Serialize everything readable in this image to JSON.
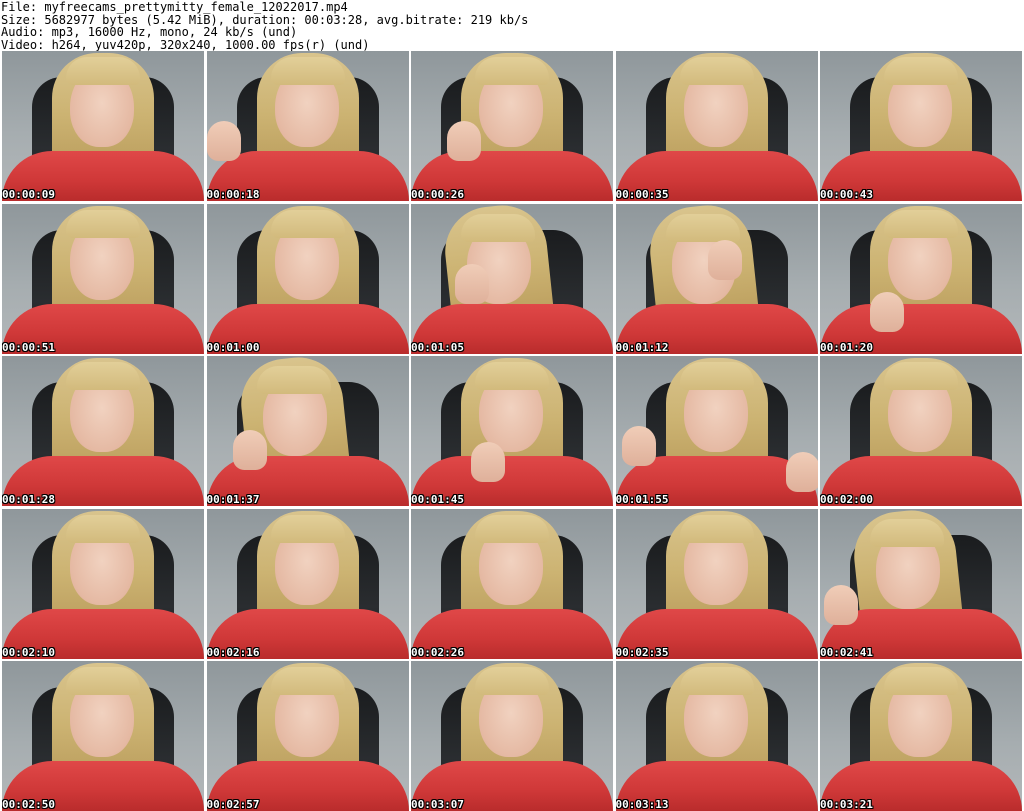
{
  "header": {
    "file_line": "File: myfreecams_prettymitty_female_12022017.mp4",
    "size_line": "Size: 5682977 bytes (5.42 MiB), duration: 00:03:28, avg.bitrate: 219 kb/s",
    "audio_line": "Audio: mp3, 16000 Hz, mono, 24 kb/s (und)",
    "video_line": "Video: h264, yuv420p, 320x240, 1000.00 fps(r) (und)"
  },
  "thumbnails": [
    {
      "timestamp": "00:00:09"
    },
    {
      "timestamp": "00:00:18"
    },
    {
      "timestamp": "00:00:26"
    },
    {
      "timestamp": "00:00:35"
    },
    {
      "timestamp": "00:00:43"
    },
    {
      "timestamp": "00:00:51"
    },
    {
      "timestamp": "00:01:00"
    },
    {
      "timestamp": "00:01:05"
    },
    {
      "timestamp": "00:01:12"
    },
    {
      "timestamp": "00:01:20"
    },
    {
      "timestamp": "00:01:28"
    },
    {
      "timestamp": "00:01:37"
    },
    {
      "timestamp": "00:01:45"
    },
    {
      "timestamp": "00:01:55"
    },
    {
      "timestamp": "00:02:00"
    },
    {
      "timestamp": "00:02:10"
    },
    {
      "timestamp": "00:02:16"
    },
    {
      "timestamp": "00:02:26"
    },
    {
      "timestamp": "00:02:35"
    },
    {
      "timestamp": "00:02:41"
    },
    {
      "timestamp": "00:02:50"
    },
    {
      "timestamp": "00:02:57"
    },
    {
      "timestamp": "00:03:07"
    },
    {
      "timestamp": "00:03:13"
    },
    {
      "timestamp": "00:03:21"
    }
  ]
}
